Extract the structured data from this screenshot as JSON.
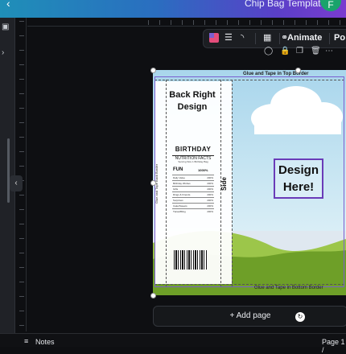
{
  "header": {
    "title": "Chip Bag Template",
    "avatar_letter": "F"
  },
  "toolbar": {
    "animate_label": "Animate",
    "position_label": "Po"
  },
  "canvas": {
    "top_border_text": "Glue and Tape in Top  Border",
    "bottom_border_text": "Glue and Tape in Bottom Border",
    "back_right_line1": "Back Right",
    "back_right_line2": "Design",
    "birthday": "BIRTHDAY",
    "nutrition_title": "NUTRITION FACTS",
    "nutrition_sub": "Serving Size 1 Birthday Bag",
    "fun_label": "FUN",
    "fun_value": "1000%",
    "side_label": "Side",
    "side_small": "Glue and Tape Back Border",
    "design_line1": "Design",
    "design_line2": "Here!",
    "nutrition_rows": [
      {
        "label": "Daily Value",
        "value": "200%"
      },
      {
        "label": "Birthday Wishes",
        "value": "200%"
      },
      {
        "label": "Gifts",
        "value": "200%"
      },
      {
        "label": "Rings & Friends",
        "value": "200%"
      },
      {
        "label": "Surprises",
        "value": "200%"
      },
      {
        "label": "Cake/Sweets",
        "value": "200%"
      },
      {
        "label": "Tiaras/Bling",
        "value": "200%"
      }
    ]
  },
  "add_page": {
    "label": "Add page"
  },
  "bottom": {
    "notes_label": "Notes",
    "page_label": "Page 1 /"
  },
  "colors": {
    "selection": "#7b5fd0",
    "grass_dark": "#6e9f28",
    "grass_light": "#9cc64a",
    "sky": "#a9d6ec"
  }
}
